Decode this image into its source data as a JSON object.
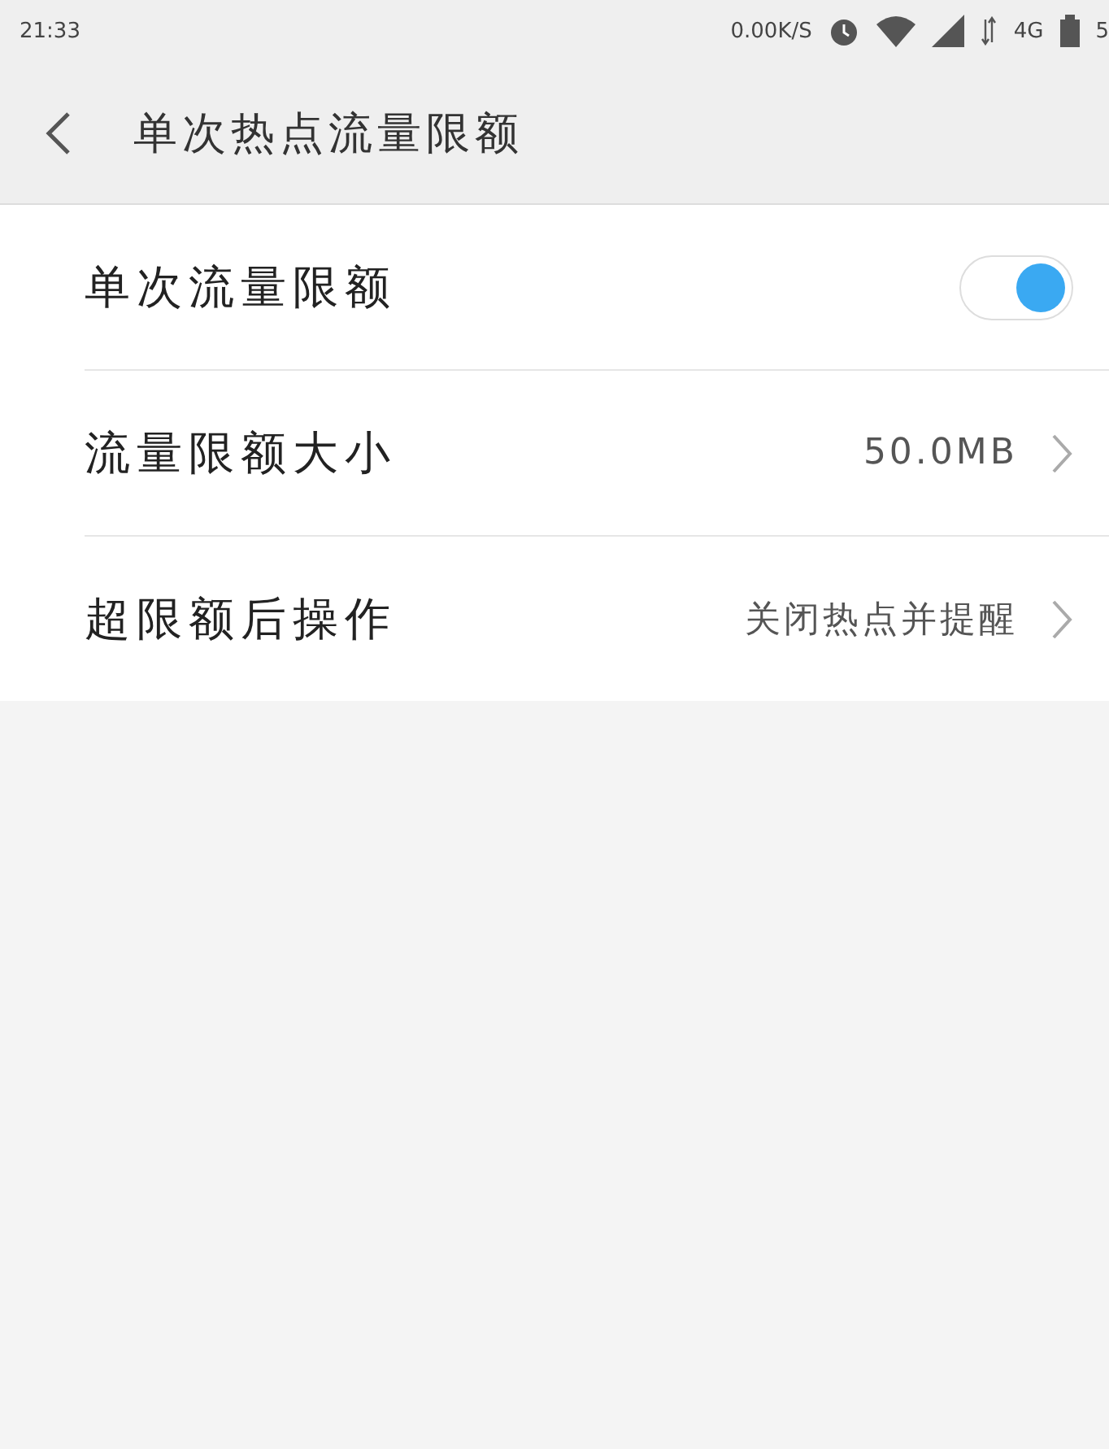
{
  "status_bar": {
    "time": "21:33",
    "speed": "0.00K/S",
    "network": "4G",
    "battery": "5"
  },
  "header": {
    "title": "单次热点流量限额"
  },
  "settings": [
    {
      "kind": "toggle",
      "label": "单次流量限额",
      "on": true
    },
    {
      "kind": "link",
      "label": "流量限额大小",
      "value": "50.0MB"
    },
    {
      "kind": "link",
      "label": "超限额后操作",
      "value": "关闭热点并提醒"
    }
  ]
}
